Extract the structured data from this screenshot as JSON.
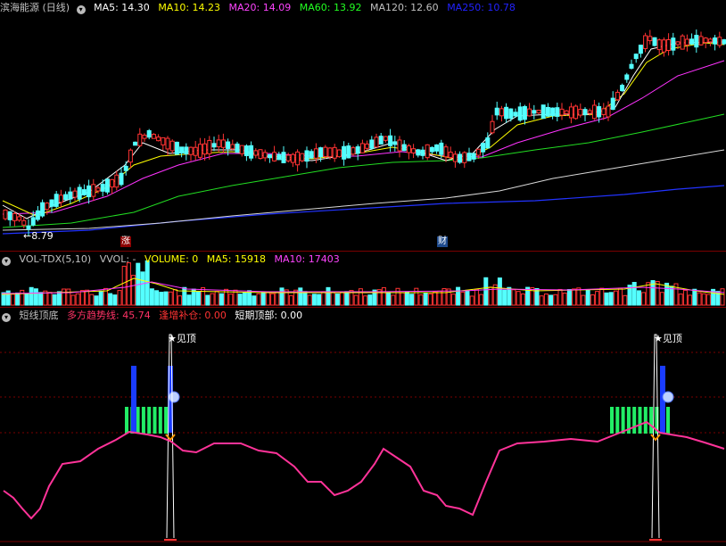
{
  "header": {
    "title": "滨海能源 (日线)",
    "ma5": "MA5: 14.30",
    "ma10": "MA10: 14.23",
    "ma20": "MA20: 14.09",
    "ma60": "MA60: 13.92",
    "ma120": "MA120: 12.60",
    "ma250": "MA250: 10.78",
    "colors": {
      "ma5": "#ffffff",
      "ma10": "#ffff00",
      "ma20": "#ff00ff",
      "ma60": "#00ff00",
      "ma120": "#c0c0c0",
      "ma250": "#0000ff"
    }
  },
  "price_panel": {
    "low_label": "←8.79",
    "badges": [
      "涨",
      "财"
    ]
  },
  "volume_panel": {
    "title": "VOL-TDX(5,10)",
    "vvol": "VVOL: -",
    "volume": "VOLUME: 0",
    "ma5": "MA5: 15918",
    "ma10": "MA10: 17403"
  },
  "indicator_panel": {
    "title": "短线顶底",
    "trend": "多方趋势线: 45.74",
    "addpos": "逢增补仓: 0.00",
    "top": "短期顶部: 0.00",
    "flag_label": "见顶"
  },
  "chart_data": [
    {
      "type": "candlestick",
      "title": "滨海能源 (日线)",
      "low_marker": 8.79,
      "ylim": [
        8.4,
        17.6
      ],
      "moving_averages": {
        "MA5": 14.3,
        "MA10": 14.23,
        "MA20": 14.09,
        "MA60": 13.92,
        "MA120": 12.6,
        "MA250": 10.78
      }
    },
    {
      "type": "bar",
      "title": "VOL-TDX(5,10)",
      "moving_averages": {
        "MA5": 15918,
        "MA10": 17403
      }
    },
    {
      "type": "line",
      "title": "短线顶底",
      "series": [
        {
          "name": "多方趋势线",
          "last": 45.74
        }
      ],
      "signals": [
        "见顶",
        "见顶"
      ]
    }
  ]
}
